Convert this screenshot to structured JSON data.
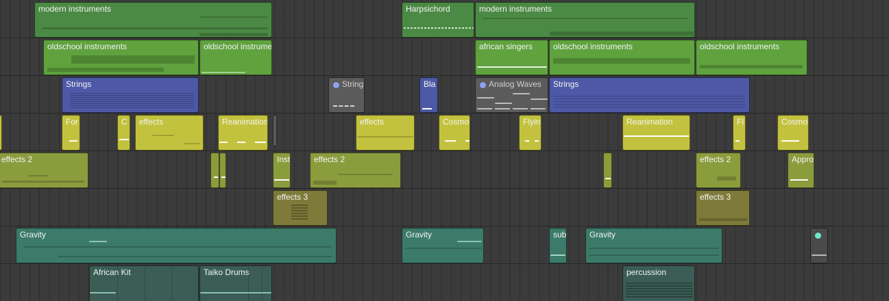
{
  "regions": [
    {
      "name": "modern instruments",
      "color": "#4b8a44",
      "label": "modern instruments"
    },
    {
      "name": "harpsichord",
      "color": "#4b8a44",
      "label": "Harpsichord"
    },
    {
      "name": "modern instruments 2",
      "color": "#4b8a44",
      "label": "modern instruments"
    },
    {
      "name": "oldschool instruments",
      "color": "#5fa23e",
      "label": "oldschool instruments"
    },
    {
      "name": "oldschool instruments 2",
      "color": "#5fa23e",
      "label": "oldschool instrume"
    },
    {
      "name": "african singers",
      "color": "#5fa23e",
      "label": "african singers"
    },
    {
      "name": "oldschool instruments 3",
      "color": "#5fa23e",
      "label": "oldschool instruments"
    },
    {
      "name": "oldschool instruments 4",
      "color": "#5fa23e",
      "label": "oldschool instruments"
    },
    {
      "name": "strings",
      "color": "#4d59a6",
      "label": "Strings"
    },
    {
      "name": "string muted",
      "color": "#5b5b5b",
      "label": "String"
    },
    {
      "name": "bla",
      "color": "#4d59a6",
      "label": "Bla"
    },
    {
      "name": "analog waves",
      "color": "#5b5b5b",
      "label": "Analog Waves"
    },
    {
      "name": "strings 2",
      "color": "#4d59a6",
      "label": "Strings"
    },
    {
      "name": "for",
      "color": "#c3c23e",
      "label": "For"
    },
    {
      "name": "c",
      "color": "#c3c23e",
      "label": "C"
    },
    {
      "name": "effects",
      "color": "#c3c23e",
      "label": "effects"
    },
    {
      "name": "reanimation",
      "color": "#c3c23e",
      "label": "Reanimation"
    },
    {
      "name": "effects b",
      "color": "#c3c23e",
      "label": "effects"
    },
    {
      "name": "cosmol",
      "color": "#c3c23e",
      "label": "Cosmol"
    },
    {
      "name": "flyin",
      "color": "#c3c23e",
      "label": "Flyin"
    },
    {
      "name": "reanimation 2",
      "color": "#c3c23e",
      "label": "Reanimation"
    },
    {
      "name": "fl",
      "color": "#c3c23e",
      "label": "Fl"
    },
    {
      "name": "cosmol 2",
      "color": "#c3c23e",
      "label": "Cosmol"
    },
    {
      "name": "effects 2",
      "color": "#8b9c3d",
      "label": "effects 2"
    },
    {
      "name": "inst",
      "color": "#8b9c3d",
      "label": "Inst"
    },
    {
      "name": "effects 2 b",
      "color": "#8b9c3d",
      "label": "effects 2"
    },
    {
      "name": "effects 2 c",
      "color": "#8b9c3d",
      "label": "effects 2"
    },
    {
      "name": "appro",
      "color": "#8b9c3d",
      "label": "Appro"
    },
    {
      "name": "effects 3",
      "color": "#7e7b3a",
      "label": "effects 3"
    },
    {
      "name": "effects 3 b",
      "color": "#7e7b3a",
      "label": "effects 3"
    },
    {
      "name": "gravity",
      "color": "#3c7a69",
      "label": "Gravity"
    },
    {
      "name": "gravity 2",
      "color": "#3c7a69",
      "label": "Gravity"
    },
    {
      "name": "sub",
      "color": "#3c7a69",
      "label": "sub"
    },
    {
      "name": "gravity 3",
      "color": "#3c7a69",
      "label": "Gravity"
    },
    {
      "name": "african kit",
      "color": "#3b5d55",
      "label": "African Kit"
    },
    {
      "name": "taiko drums",
      "color": "#3b5d55",
      "label": "Taiko Drums"
    },
    {
      "name": "percussion",
      "color": "#3b5d55",
      "label": "percussion"
    }
  ]
}
